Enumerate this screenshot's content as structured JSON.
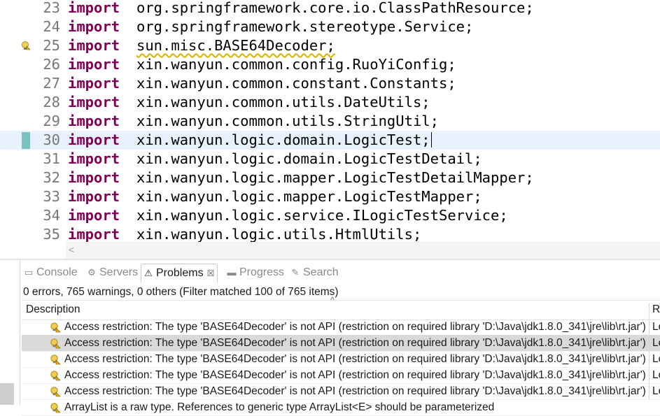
{
  "editor": {
    "lines": [
      {
        "num": "23",
        "keyword": "import",
        "text": "org.springframework.core.io.ClassPathResource;"
      },
      {
        "num": "24",
        "keyword": "import",
        "text": "org.springframework.stereotype.Service;"
      },
      {
        "num": "25",
        "keyword": "import",
        "text": "sun.misc.BASE64Decoder;"
      },
      {
        "num": "26",
        "keyword": "import",
        "text": "xin.wanyun.common.config.RuoYiConfig;"
      },
      {
        "num": "27",
        "keyword": "import",
        "text": "xin.wanyun.common.constant.Constants;"
      },
      {
        "num": "28",
        "keyword": "import",
        "text": "xin.wanyun.common.utils.DateUtils;"
      },
      {
        "num": "29",
        "keyword": "import",
        "text": "xin.wanyun.common.utils.StringUtil;"
      },
      {
        "num": "30",
        "keyword": "import",
        "text": "xin.wanyun.logic.domain.LogicTest;"
      },
      {
        "num": "31",
        "keyword": "import",
        "text": "xin.wanyun.logic.domain.LogicTestDetail;"
      },
      {
        "num": "32",
        "keyword": "import",
        "text": "xin.wanyun.logic.mapper.LogicTestDetailMapper;"
      },
      {
        "num": "33",
        "keyword": "import",
        "text": "xin.wanyun.logic.mapper.LogicTestMapper;"
      },
      {
        "num": "34",
        "keyword": "import",
        "text": "xin.wanyun.logic.service.ILogicTestService;"
      },
      {
        "num": "35",
        "keyword": "import",
        "text": "xin.wanyun.logic.utils.HtmlUtils;"
      }
    ],
    "warning_line": "25",
    "current_line": "30",
    "scroll_left_arrow": "<",
    "colors": {
      "keyword": "#7f0055",
      "line_number": "#787878",
      "current_line_bg": "#e8f2fe"
    }
  },
  "views": {
    "tabs": [
      {
        "label": "Console",
        "icon": "console-icon",
        "glyph": "▭"
      },
      {
        "label": "Servers",
        "icon": "servers-icon",
        "glyph": "⚙"
      },
      {
        "label": "Problems",
        "icon": "problems-icon",
        "glyph": "⚠",
        "active": true,
        "close": "☒"
      },
      {
        "label": "Progress",
        "icon": "progress-icon",
        "glyph": "▬"
      },
      {
        "label": "Search",
        "icon": "search-icon",
        "glyph": "✎"
      }
    ],
    "summary": "0 errors, 765 warnings, 0 others (Filter matched 100 of 765 items)",
    "columns": {
      "description": "Description",
      "resource": "R",
      "sort_glyph": "^"
    },
    "rows": [
      {
        "text": "Access restriction: The type 'BASE64Decoder' is not API (restriction on required library 'D:\\Java\\jdk1.8.0_341\\jre\\lib\\rt.jar')",
        "res": "Lo"
      },
      {
        "text": "Access restriction: The type 'BASE64Decoder' is not API (restriction on required library 'D:\\Java\\jdk1.8.0_341\\jre\\lib\\rt.jar')",
        "res": "Lo",
        "selected": true
      },
      {
        "text": "Access restriction: The type 'BASE64Decoder' is not API (restriction on required library 'D:\\Java\\jdk1.8.0_341\\jre\\lib\\rt.jar')",
        "res": "Lo"
      },
      {
        "text": "Access restriction: The type 'BASE64Decoder' is not API (restriction on required library 'D:\\Java\\jdk1.8.0_341\\jre\\lib\\rt.jar')",
        "res": "Lo"
      },
      {
        "text": "Access restriction: The type 'BASE64Decoder' is not API (restriction on required library 'D:\\Java\\jdk1.8.0_341\\jre\\lib\\rt.jar')",
        "res": "Lo"
      },
      {
        "text": "ArrayList is a raw type. References to generic type ArrayList<E> should be parameterized",
        "res": ""
      }
    ]
  }
}
